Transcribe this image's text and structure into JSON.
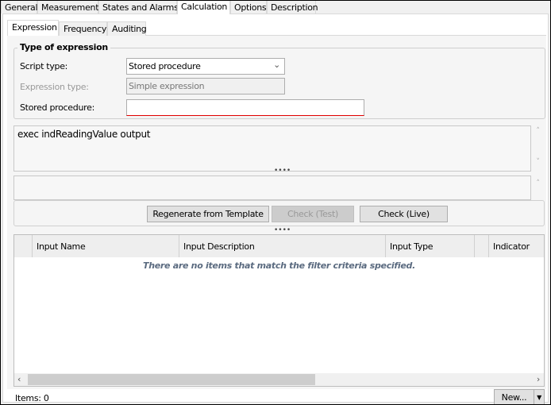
{
  "top_tabs": [
    "General",
    "Measurement",
    "States and Alarms",
    "Calculation",
    "Options",
    "Description"
  ],
  "sub_tabs": [
    "Expression",
    "Frequency",
    "Auditing"
  ],
  "group": {
    "title": "Type of expression",
    "script_type_label": "Script type:",
    "script_type_value": "Stored procedure",
    "expression_type_label": "Expression type:",
    "expression_type_value": "Simple expression",
    "stored_procedure_label": "Stored procedure:",
    "stored_procedure_value": ""
  },
  "expression_text": "exec  indReadingValue output",
  "buttons": {
    "regenerate": "Regenerate from Template",
    "check_test": "Check (Test)",
    "check_live": "Check (Live)"
  },
  "grid": {
    "columns": [
      "",
      "Input Name",
      "Input Description",
      "Input Type",
      "",
      "Indicator"
    ],
    "empty_message": "There are no items that match the filter criteria specified."
  },
  "footer": {
    "items": "Items: 0",
    "new_button": "New..."
  },
  "colors": {
    "error_underline": "#e00000",
    "empty_text": "#5b6b80"
  }
}
